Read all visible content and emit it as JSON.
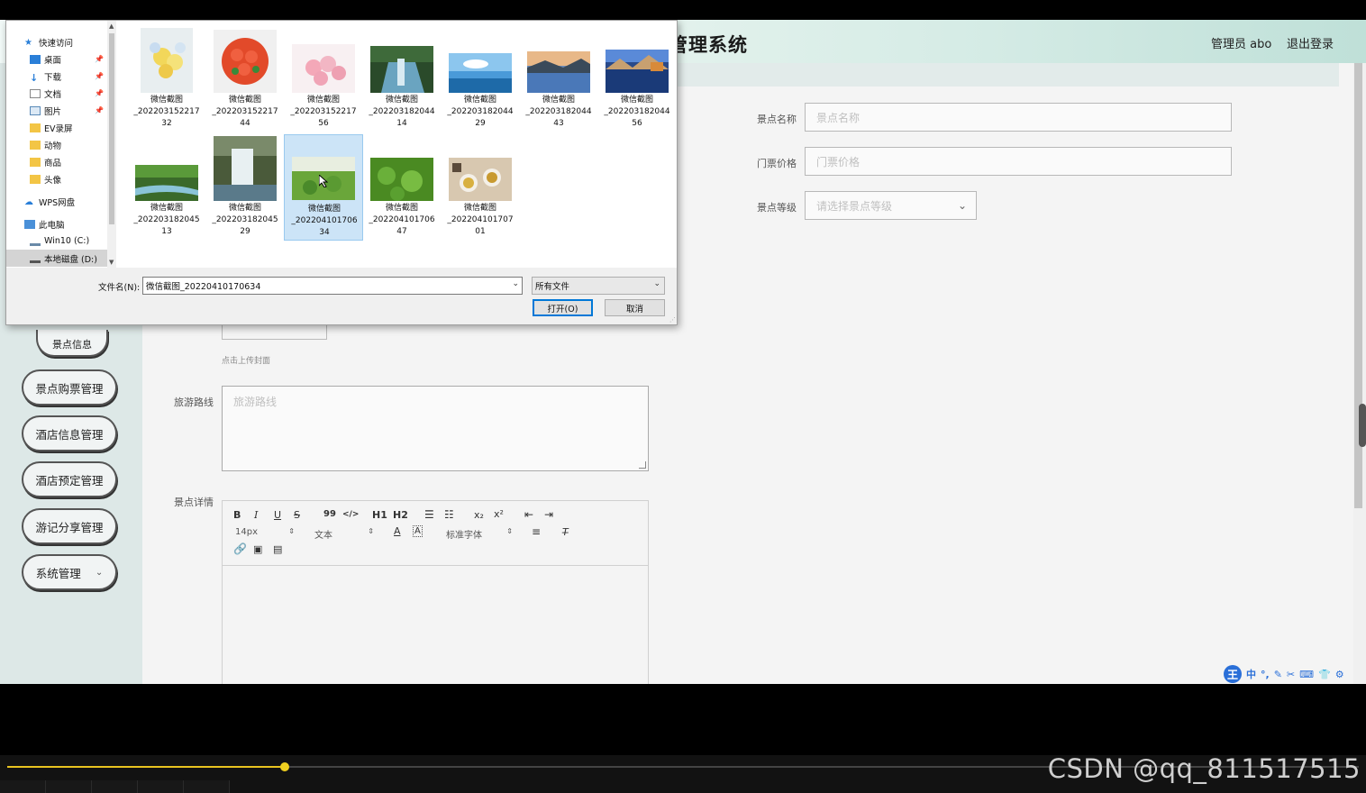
{
  "header": {
    "app_title": "管理系统",
    "admin_label": "管理员 abo",
    "logout_label": "退出登录"
  },
  "sidebar": {
    "items": [
      {
        "label": "景点信息"
      },
      {
        "label": "景点购票管理"
      },
      {
        "label": "酒店信息管理"
      },
      {
        "label": "酒店预定管理"
      },
      {
        "label": "游记分享管理"
      },
      {
        "label": "系统管理"
      }
    ]
  },
  "form": {
    "name_label": "景点名称",
    "name_placeholder": "景点名称",
    "price_label": "门票价格",
    "price_placeholder": "门票价格",
    "level_label": "景点等级",
    "level_placeholder": "请选择景点等级",
    "upload_hint": "点击上传封面",
    "route_label": "旅游路线",
    "route_placeholder": "旅游路线",
    "detail_label": "景点详情"
  },
  "editor": {
    "row1": [
      "B",
      "I",
      "U",
      "S",
      "99",
      "</>",
      "H1",
      "H2",
      "ol",
      "ul",
      "x₂",
      "x²",
      "outdent",
      "indent"
    ],
    "font_size": "14px",
    "paragraph": "文本",
    "font_family": "标准字体"
  },
  "dialog": {
    "nav": [
      {
        "label": "快速访问",
        "pinned": false
      },
      {
        "label": "桌面",
        "pinned": true
      },
      {
        "label": "下载",
        "pinned": true
      },
      {
        "label": "文档",
        "pinned": true
      },
      {
        "label": "图片",
        "pinned": true
      },
      {
        "label": "EV录屏",
        "pinned": false
      },
      {
        "label": "动物",
        "pinned": false
      },
      {
        "label": "商品",
        "pinned": false
      },
      {
        "label": "头像",
        "pinned": false
      },
      {
        "label": "WPS网盘",
        "pinned": false
      },
      {
        "label": "此电脑",
        "pinned": false
      },
      {
        "label": "Win10 (C:)",
        "pinned": false
      },
      {
        "label": "本地磁盘 (D:)",
        "pinned": false
      }
    ],
    "files": [
      {
        "name": "微信截图\n_202203152217\n32"
      },
      {
        "name": "微信截图\n_202203152217\n44"
      },
      {
        "name": "微信截图\n_202203152217\n56"
      },
      {
        "name": "微信截图\n_202203182044\n14"
      },
      {
        "name": "微信截图\n_202203182044\n29"
      },
      {
        "name": "微信截图\n_202203182044\n43"
      },
      {
        "name": "微信截图\n_202203182044\n56"
      },
      {
        "name": "微信截图\n_202203182045\n13"
      },
      {
        "name": "微信截图\n_202203182045\n29"
      },
      {
        "name": "微信截图\n_202204101706\n34"
      },
      {
        "name": "微信截图\n_202204101706\n47"
      },
      {
        "name": "微信截图\n_202204101707\n01"
      }
    ],
    "filename_label": "文件名(N):",
    "filename_value": "微信截图_20220410170634",
    "filetype_value": "所有文件",
    "open_label": "打开(O)",
    "cancel_label": "取消"
  },
  "ime": {
    "logo": "王",
    "items": [
      "中",
      "°,",
      "✎",
      "✂",
      "⌨",
      "👕",
      "⚙"
    ]
  },
  "player": {
    "progress": 0.205
  },
  "watermark": "CSDN @qq_811517515",
  "colors": {
    "accent": "#0078d7",
    "progress": "#e8c320",
    "ime": "#2a6fd8"
  }
}
